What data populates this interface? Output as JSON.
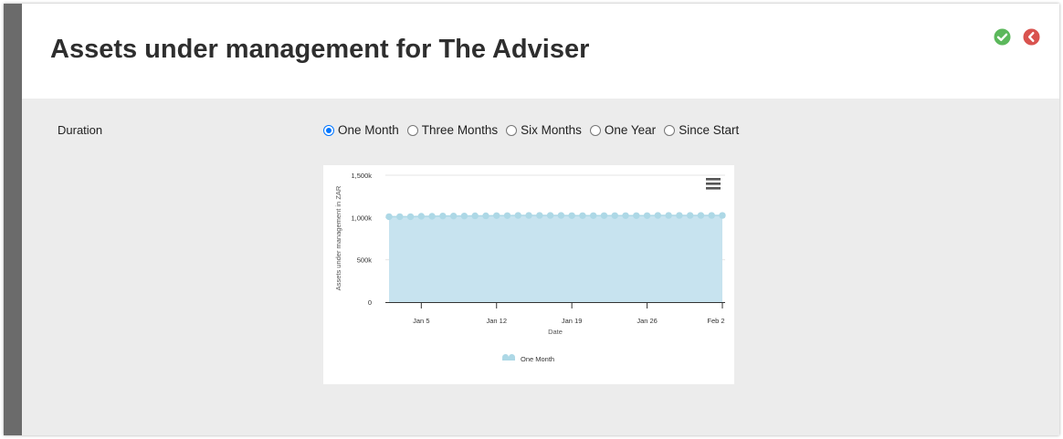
{
  "header": {
    "title": "Assets under management for The Adviser",
    "icons": [
      "check-circle-icon",
      "back-circle-icon"
    ],
    "colors": {
      "confirm": "#5cb85c",
      "back": "#d9534f"
    }
  },
  "duration": {
    "label": "Duration",
    "options": [
      "One Month",
      "Three Months",
      "Six Months",
      "One Year",
      "Since Start"
    ],
    "selected": "One Month"
  },
  "chart_data": {
    "type": "area",
    "title": "",
    "xlabel": "Date",
    "ylabel": "Assets under management in ZAR",
    "ylim": [
      0,
      1500000
    ],
    "y_ticks": [
      "0",
      "500k",
      "1,000k",
      "1,500k"
    ],
    "x_ticks": [
      "Jan 5",
      "Jan 12",
      "Jan 19",
      "Jan 26",
      "Feb 2"
    ],
    "grid": true,
    "legend": "bottom-center",
    "menu_icon": "hamburger-icon",
    "series": [
      {
        "name": "One Month",
        "color": "#c7e3ef",
        "marker_color": "#add8e6",
        "x": [
          "2020-01-02",
          "2020-01-03",
          "2020-01-04",
          "2020-01-05",
          "2020-01-06",
          "2020-01-07",
          "2020-01-08",
          "2020-01-09",
          "2020-01-10",
          "2020-01-11",
          "2020-01-12",
          "2020-01-13",
          "2020-01-14",
          "2020-01-15",
          "2020-01-16",
          "2020-01-17",
          "2020-01-18",
          "2020-01-19",
          "2020-01-20",
          "2020-01-21",
          "2020-01-22",
          "2020-01-23",
          "2020-01-24",
          "2020-01-25",
          "2020-01-26",
          "2020-01-27",
          "2020-01-28",
          "2020-01-29",
          "2020-01-30",
          "2020-01-31",
          "2020-02-01",
          "2020-02-02"
        ],
        "values": [
          1010000,
          1010000,
          1010000,
          1015000,
          1015000,
          1018000,
          1018000,
          1018000,
          1020000,
          1020000,
          1022000,
          1022000,
          1025000,
          1025000,
          1025000,
          1025000,
          1025000,
          1022000,
          1022000,
          1022000,
          1022000,
          1022000,
          1022000,
          1022000,
          1022000,
          1025000,
          1025000,
          1025000,
          1025000,
          1025000,
          1025000,
          1025000
        ]
      }
    ]
  }
}
